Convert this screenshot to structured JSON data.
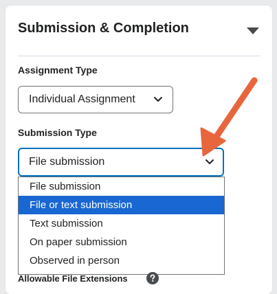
{
  "section": {
    "title": "Submission & Completion"
  },
  "assignment_type": {
    "label": "Assignment Type",
    "value": "Individual Assignment"
  },
  "submission_type": {
    "label": "Submission Type",
    "value": "File submission",
    "options": [
      "File submission",
      "File or text submission",
      "Text submission",
      "On paper submission",
      "Observed in person"
    ],
    "highlighted_option": "File or text submission"
  },
  "allowable_extensions": {
    "label": "Allowable File Extensions"
  },
  "colors": {
    "highlight": "#1967d2",
    "arrow": "#e8663d",
    "focus_border": "#006fbf"
  },
  "icons": {
    "collapse": "triangle-down-icon",
    "select": "chevron-down-icon",
    "help": "help-circle-icon",
    "annotation": "annotation-arrow"
  }
}
